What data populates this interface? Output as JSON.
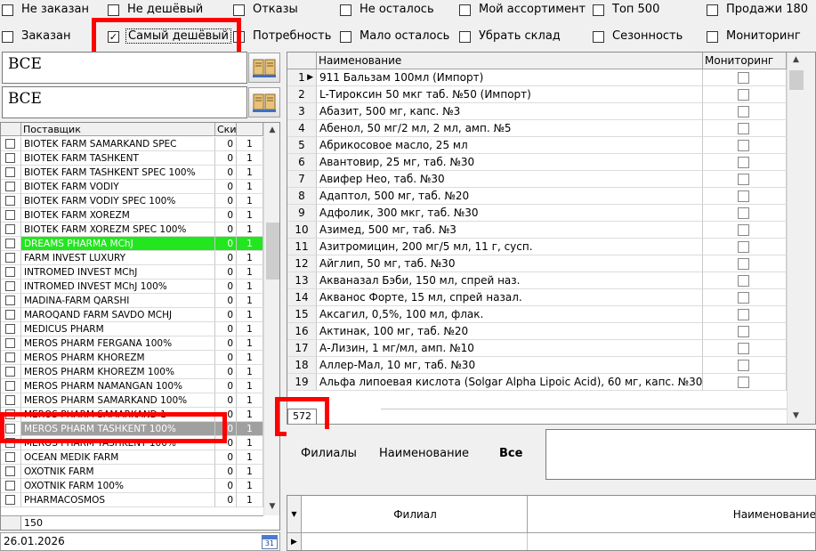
{
  "filters": {
    "row1": [
      {
        "label": "Не заказан",
        "checked": false
      },
      {
        "label": "Не дешёвый",
        "checked": false
      },
      {
        "label": "Отказы",
        "checked": false
      },
      {
        "label": "Не осталось",
        "checked": false
      },
      {
        "label": "Мой ассортимент",
        "checked": false
      },
      {
        "label": "Топ 500",
        "checked": false
      },
      {
        "label": "Продажи 180",
        "checked": false
      }
    ],
    "row2": [
      {
        "label": "Заказан",
        "checked": false
      },
      {
        "label": "Самый дешёвый",
        "checked": true
      },
      {
        "label": "Потребность",
        "checked": false
      },
      {
        "label": "Мало осталось",
        "checked": false
      },
      {
        "label": "Убрать склад",
        "checked": false
      },
      {
        "label": "Сезонность",
        "checked": false
      },
      {
        "label": "Мониторинг",
        "checked": false
      }
    ]
  },
  "search": {
    "field1": "ВСЕ",
    "field2": "ВСЕ"
  },
  "suppliers": {
    "headers": {
      "name": "Поставщик",
      "discount": "Ски"
    },
    "rows": [
      {
        "name": "BIOTEK FARM SAMARKAND SPEC",
        "a": "0",
        "b": "1"
      },
      {
        "name": "BIOTEK FARM TASHKENT",
        "a": "0",
        "b": "1"
      },
      {
        "name": "BIOTEK FARM TASHKENT SPEC 100%",
        "a": "0",
        "b": "1"
      },
      {
        "name": "BIOTEK FARM VODIY",
        "a": "0",
        "b": "1"
      },
      {
        "name": "BIOTEK FARM VODIY SPEC 100%",
        "a": "0",
        "b": "1"
      },
      {
        "name": "BIOTEK FARM XOREZM",
        "a": "0",
        "b": "1"
      },
      {
        "name": "BIOTEK FARM XOREZM SPEC 100%",
        "a": "0",
        "b": "1"
      },
      {
        "name": "DREAMS PHARMA MChJ",
        "a": "0",
        "b": "1",
        "highlight": "green"
      },
      {
        "name": "FARM INVEST LUXURY",
        "a": "0",
        "b": "1"
      },
      {
        "name": "INTROMED INVEST MChJ",
        "a": "0",
        "b": "1"
      },
      {
        "name": "INTROMED INVEST MChJ 100%",
        "a": "0",
        "b": "1"
      },
      {
        "name": "MADINA-FARM QARSHI",
        "a": "0",
        "b": "1"
      },
      {
        "name": "MAROQAND FARM SAVDO MCHJ",
        "a": "0",
        "b": "1"
      },
      {
        "name": "MEDICUS PHARM",
        "a": "0",
        "b": "1"
      },
      {
        "name": "MEROS PHARM FERGANA 100%",
        "a": "0",
        "b": "1"
      },
      {
        "name": "MEROS PHARM KHOREZM",
        "a": "0",
        "b": "1"
      },
      {
        "name": "MEROS PHARM KHOREZM 100%",
        "a": "0",
        "b": "1"
      },
      {
        "name": "MEROS PHARM NAMANGAN 100%",
        "a": "0",
        "b": "1"
      },
      {
        "name": "MEROS PHARM SAMARKAND 100%",
        "a": "0",
        "b": "1"
      },
      {
        "name": "MEROS PHARM SAMARKAND 1",
        "a": "0",
        "b": "1"
      },
      {
        "name": "MEROS PHARM TASHKENT 100%",
        "a": "0",
        "b": "1",
        "highlight": "gray"
      },
      {
        "name": "MEROS PHARM TASHKENT 100%",
        "a": "0",
        "b": "1"
      },
      {
        "name": "OCEAN MEDIK FARM",
        "a": "0",
        "b": "1"
      },
      {
        "name": "OXOTNIK FARM",
        "a": "0",
        "b": "1"
      },
      {
        "name": "OXOTNIK FARM 100%",
        "a": "0",
        "b": "1"
      },
      {
        "name": "PHARMACOSMOS",
        "a": "0",
        "b": "1"
      }
    ],
    "footer_count": "150",
    "date": "26.01.2026",
    "calendar_label": "31"
  },
  "products": {
    "headers": {
      "name": "Наименование",
      "monitoring": "Мониторинг"
    },
    "rows": [
      {
        "n": "1",
        "name": "911 Бальзам 100мл (Импорт)"
      },
      {
        "n": "2",
        "name": "L-Тироксин 50 мкг таб. №50 (Импорт)"
      },
      {
        "n": "3",
        "name": "Абазит, 500 мг, капс. №3"
      },
      {
        "n": "4",
        "name": "Абенол, 50 мг/2 мл, 2 мл, амп. №5"
      },
      {
        "n": "5",
        "name": "Абрикосовое масло, 25 мл"
      },
      {
        "n": "6",
        "name": "Авантовир, 25 мг, таб. №30"
      },
      {
        "n": "7",
        "name": "Авифер Нео, таб. №30"
      },
      {
        "n": "8",
        "name": "Адаптол, 500 мг, таб. №20"
      },
      {
        "n": "9",
        "name": "Адфолик, 300 мкг, таб. №30"
      },
      {
        "n": "10",
        "name": "Азимед, 500 мг, таб. №3"
      },
      {
        "n": "11",
        "name": "Азитромицин, 200 мг/5 мл, 11 г, сусп."
      },
      {
        "n": "12",
        "name": "Айглип, 50 мг, таб. №30"
      },
      {
        "n": "13",
        "name": "Акваназал Бэби, 150 мл, спрей наз."
      },
      {
        "n": "14",
        "name": "Акванос Форте, 15 мл, спрей назал."
      },
      {
        "n": "15",
        "name": "Аксагил, 0,5%, 100 мл, флак."
      },
      {
        "n": "16",
        "name": "Актинак, 100 мг, таб. №20"
      },
      {
        "n": "17",
        "name": "А-Лизин, 1 мг/мл, амп. №10"
      },
      {
        "n": "18",
        "name": "Аллер-Мал, 10 мг, таб. №30"
      },
      {
        "n": "19",
        "name": "Альфа липоевая кислота (Solgar Alpha Lipoic Acid), 60 мг, капс. №30"
      }
    ],
    "count": "572"
  },
  "tabs": {
    "branches": "Филиалы",
    "name": "Наименование",
    "all": "Все"
  },
  "bottom_grid": {
    "headers": {
      "branch": "Филиал",
      "name": "Наименование"
    }
  },
  "colors": {
    "highlight_red": "#ff0000",
    "supplier_green": "#22e61e",
    "supplier_gray": "#a0a0a0"
  }
}
